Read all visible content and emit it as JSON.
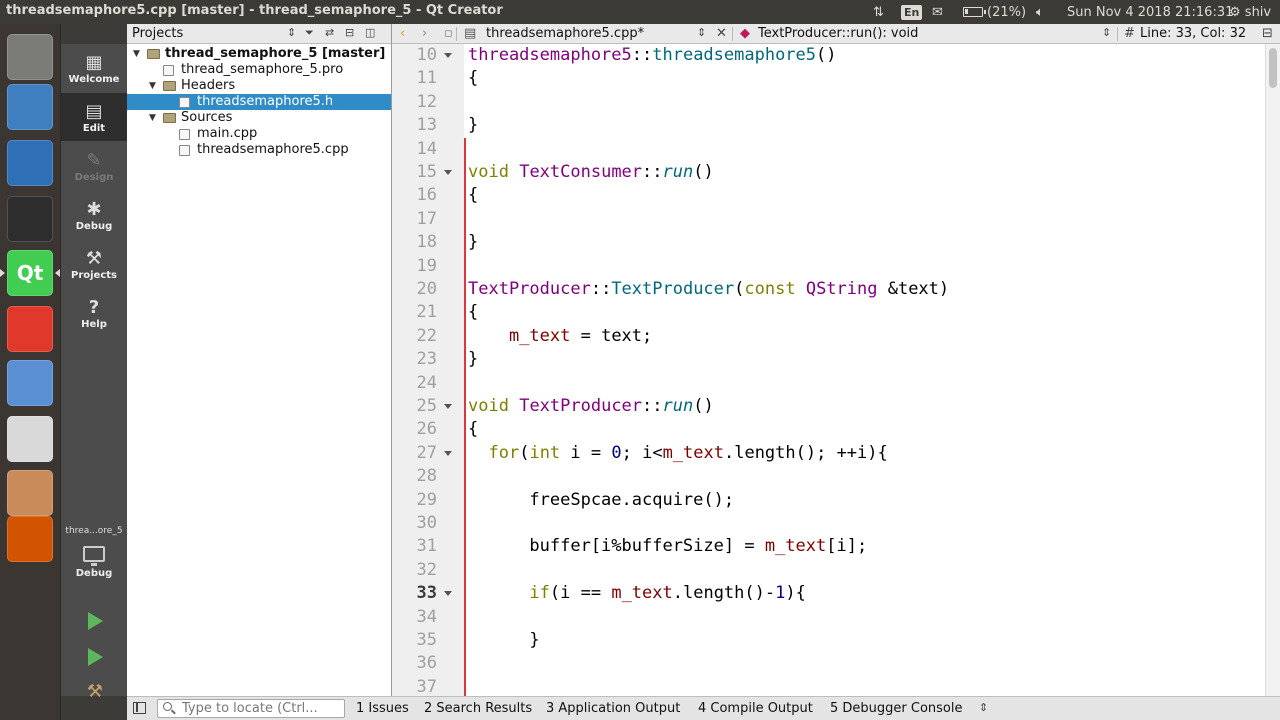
{
  "window": {
    "title": "threadsemaphore5.cpp [master] - thread_semaphore_5 - Qt Creator"
  },
  "system_tray": {
    "keyboard_layout": "En",
    "battery_percent": 21,
    "battery_label": "(21%)",
    "clock": "Sun Nov  4 2018 21:16:31",
    "user": "shiv"
  },
  "launcher": {
    "items": [
      {
        "icon": "ubuntu-dash-icon",
        "color": "#7b7b78"
      },
      {
        "icon": "video-editor-icon",
        "color": "#3f7fbf"
      },
      {
        "icon": "media-player-icon",
        "color": "#2f6fb5"
      },
      {
        "icon": "terminal-icon",
        "color": "#2d2d2d"
      },
      {
        "icon": "qt-creator-icon",
        "color": "#41cd52",
        "label": "Qt"
      },
      {
        "icon": "git-client-icon",
        "color": "#e0392b"
      },
      {
        "icon": "virtualbox-icon",
        "color": "#5a8fd4"
      },
      {
        "icon": "chrome-icon",
        "color": "#d9d9d9"
      },
      {
        "icon": "file-manager-icon",
        "color": "#c98b5a"
      },
      {
        "icon": "stacked-apps-icon",
        "color": "#d35400"
      }
    ]
  },
  "modebar": {
    "modes": [
      {
        "label": "Welcome",
        "icon": "grid-icon",
        "glyph": "▦",
        "state": "normal"
      },
      {
        "label": "Edit",
        "icon": "edit-icon",
        "glyph": "▤",
        "state": "active"
      },
      {
        "label": "Design",
        "icon": "design-icon",
        "glyph": "✎",
        "state": "disabled"
      },
      {
        "label": "Debug",
        "icon": "bug-icon",
        "glyph": "✱",
        "state": "normal"
      },
      {
        "label": "Projects",
        "icon": "wrench-icon",
        "glyph": "⚒",
        "state": "normal"
      },
      {
        "label": "Help",
        "icon": "help-icon",
        "glyph": "?",
        "state": "normal"
      }
    ],
    "kit": {
      "project_label": "threa...ore_5",
      "build_config": "Debug"
    }
  },
  "projects": {
    "title": "Projects",
    "tree": [
      {
        "label": "thread_semaphore_5 [master]",
        "depth": 0,
        "kind": "project",
        "expanded": true,
        "bold": true,
        "selected": false
      },
      {
        "label": "thread_semaphore_5.pro",
        "depth": 1,
        "kind": "file",
        "selected": false
      },
      {
        "label": "Headers",
        "depth": 1,
        "kind": "folder",
        "expanded": true,
        "selected": false
      },
      {
        "label": "threadsemaphore5.h",
        "depth": 2,
        "kind": "header",
        "selected": true
      },
      {
        "label": "Sources",
        "depth": 1,
        "kind": "folder",
        "expanded": true,
        "selected": false
      },
      {
        "label": "main.cpp",
        "depth": 2,
        "kind": "source",
        "selected": false
      },
      {
        "label": "threadsemaphore5.cpp",
        "depth": 2,
        "kind": "source",
        "selected": false
      }
    ]
  },
  "editor_toolbar": {
    "file_name": "threadsemaphore5.cpp*",
    "symbol": "TextProducer::run(): void",
    "line_col": "Line: 33, Col: 32"
  },
  "editor": {
    "current_line": 33,
    "modified_from": 14,
    "lines": [
      {
        "n": 10,
        "fold": true,
        "code": [
          [
            "threadsemaphore5",
            "cls"
          ],
          [
            "::",
            ""
          ],
          [
            "threadsemaphore5",
            "fn"
          ],
          [
            "()",
            ""
          ]
        ]
      },
      {
        "n": 11,
        "code": [
          [
            "{",
            ""
          ]
        ]
      },
      {
        "n": 12,
        "code": []
      },
      {
        "n": 13,
        "code": [
          [
            "}",
            ""
          ]
        ]
      },
      {
        "n": 14,
        "code": []
      },
      {
        "n": 15,
        "fold": true,
        "code": [
          [
            "void",
            "kw"
          ],
          [
            " ",
            ""
          ],
          [
            "TextConsumer",
            "cls"
          ],
          [
            "::",
            ""
          ],
          [
            "run",
            "fn it"
          ],
          [
            "()",
            ""
          ]
        ]
      },
      {
        "n": 16,
        "code": [
          [
            "{",
            ""
          ]
        ]
      },
      {
        "n": 17,
        "code": []
      },
      {
        "n": 18,
        "code": [
          [
            "}",
            ""
          ]
        ]
      },
      {
        "n": 19,
        "code": []
      },
      {
        "n": 20,
        "code": [
          [
            "TextProducer",
            "cls"
          ],
          [
            "::",
            ""
          ],
          [
            "TextProducer",
            "fn"
          ],
          [
            "(",
            ""
          ],
          [
            "const",
            "kw"
          ],
          [
            " ",
            ""
          ],
          [
            "QString",
            "cls"
          ],
          [
            " &text)",
            ""
          ]
        ]
      },
      {
        "n": 21,
        "code": [
          [
            "{",
            ""
          ]
        ]
      },
      {
        "n": 22,
        "code": [
          [
            "    ",
            ""
          ],
          [
            "m_text",
            "mem"
          ],
          [
            " = text;",
            ""
          ]
        ]
      },
      {
        "n": 23,
        "code": [
          [
            "}",
            ""
          ]
        ]
      },
      {
        "n": 24,
        "code": []
      },
      {
        "n": 25,
        "fold": true,
        "code": [
          [
            "void",
            "kw"
          ],
          [
            " ",
            ""
          ],
          [
            "TextProducer",
            "cls"
          ],
          [
            "::",
            ""
          ],
          [
            "run",
            "fn it"
          ],
          [
            "()",
            ""
          ]
        ]
      },
      {
        "n": 26,
        "code": [
          [
            "{",
            ""
          ]
        ]
      },
      {
        "n": 27,
        "fold": true,
        "code": [
          [
            "  ",
            ""
          ],
          [
            "for",
            "kw"
          ],
          [
            "(",
            ""
          ],
          [
            "int",
            "kw"
          ],
          [
            " i = ",
            ""
          ],
          [
            "0",
            "num"
          ],
          [
            "; i<",
            ""
          ],
          [
            "m_text",
            "mem"
          ],
          [
            ".length(); ++i){",
            ""
          ]
        ]
      },
      {
        "n": 28,
        "code": []
      },
      {
        "n": 29,
        "code": [
          [
            "      freeSpcae.acquire();",
            ""
          ]
        ]
      },
      {
        "n": 30,
        "code": []
      },
      {
        "n": 31,
        "code": [
          [
            "      buffer[i%bufferSize] = ",
            ""
          ],
          [
            "m_text",
            "mem"
          ],
          [
            "[i];",
            ""
          ]
        ]
      },
      {
        "n": 32,
        "code": []
      },
      {
        "n": 33,
        "fold": true,
        "code": [
          [
            "      ",
            ""
          ],
          [
            "if",
            "kw"
          ],
          [
            "(i == ",
            ""
          ],
          [
            "m_text",
            "mem"
          ],
          [
            ".length()-",
            ""
          ],
          [
            "1",
            "num"
          ],
          [
            "){",
            ""
          ]
        ]
      },
      {
        "n": 34,
        "code": []
      },
      {
        "n": 35,
        "code": [
          [
            "      }",
            ""
          ]
        ]
      },
      {
        "n": 36,
        "code": []
      },
      {
        "n": 37,
        "code": []
      }
    ]
  },
  "statusbar": {
    "locator_placeholder": "Type to locate (Ctrl...",
    "panes": [
      {
        "label": "1  Issues"
      },
      {
        "label": "2  Search Results"
      },
      {
        "label": "3  Application Output"
      },
      {
        "label": "4  Compile Output"
      },
      {
        "label": "5  Debugger Console"
      }
    ]
  },
  "colors": {
    "selection": "#308cc6",
    "modified_marker": "#d8383e",
    "keyword": "#808000",
    "type": "#800080",
    "function": "#00677c",
    "member": "#800000",
    "number": "#000080"
  }
}
